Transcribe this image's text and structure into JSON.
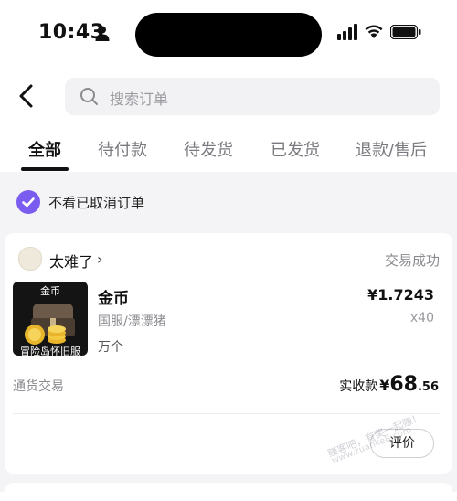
{
  "status_bar": {
    "time": "10:43"
  },
  "nav": {
    "search_placeholder": "搜索订单"
  },
  "tabs": [
    {
      "label": "全部",
      "active": true
    },
    {
      "label": "待付款",
      "active": false
    },
    {
      "label": "待发货",
      "active": false
    },
    {
      "label": "已发货",
      "active": false
    },
    {
      "label": "退款/售后",
      "active": false
    }
  ],
  "filter": {
    "label": "不看已取消订单",
    "checked": true
  },
  "order": {
    "shop_name": "太难了",
    "status": "交易成功",
    "thumbnail": {
      "title": "金币",
      "bottom_text": "冒险岛怀旧服"
    },
    "item_name": "金币",
    "server": "国服/漂漂猪",
    "unit": "万个",
    "price": "¥1.7243",
    "quantity": "x40",
    "trade_type": "通货交易",
    "paid_label": "实收款",
    "paid_currency": "¥",
    "paid_int": "68",
    "paid_dec": ".56",
    "review_label": "评价"
  },
  "watermark": {
    "line1": "赚客吧，有奖一起赚！",
    "line2": "www.zuanke8.com"
  },
  "colors": {
    "accent": "#7b5cf0",
    "page_bg": "#f4f4f6"
  }
}
